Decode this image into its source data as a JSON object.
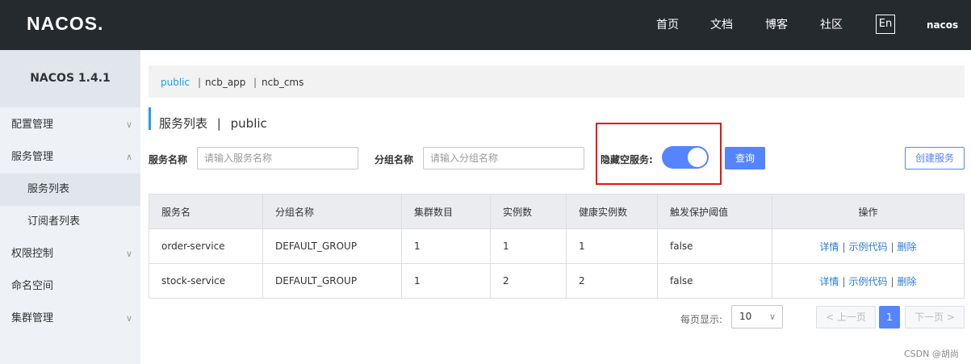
{
  "header": {
    "logo": "NACOS.",
    "nav": [
      "首页",
      "文档",
      "博客",
      "社区"
    ],
    "lang": "En",
    "user": "nacos"
  },
  "sidebar": {
    "version": "NACOS 1.4.1",
    "items": [
      {
        "label": "配置管理",
        "chevron": "∨"
      },
      {
        "label": "服务管理",
        "chevron": "∧"
      },
      {
        "label": "服务列表"
      },
      {
        "label": "订阅者列表"
      },
      {
        "label": "权限控制",
        "chevron": "∨"
      },
      {
        "label": "命名空间"
      },
      {
        "label": "集群管理",
        "chevron": "∨"
      }
    ]
  },
  "namespaces": [
    "public",
    "ncb_app",
    "ncb_cms"
  ],
  "namespace_sep": "|",
  "page": {
    "title": "服务列表",
    "title_sep": "|",
    "title_ns": "public"
  },
  "search": {
    "service_label": "服务名称",
    "service_placeholder": "请输入服务名称",
    "group_label": "分组名称",
    "group_placeholder": "请输入分组名称",
    "hide_empty_label": "隐藏空服务:",
    "hide_empty_on": true,
    "query_button": "查询",
    "create_button": "创建服务"
  },
  "table": {
    "headers": [
      "服务名",
      "分组名称",
      "集群数目",
      "实例数",
      "健康实例数",
      "触发保护阈值",
      "操作"
    ],
    "rows": [
      [
        "order-service",
        "DEFAULT_GROUP",
        "1",
        "1",
        "1",
        "false"
      ],
      [
        "stock-service",
        "DEFAULT_GROUP",
        "1",
        "2",
        "2",
        "false"
      ]
    ],
    "actions": [
      "详情",
      "示例代码",
      "删除"
    ],
    "action_sep": "|"
  },
  "pagination": {
    "page_size_label": "每页显示:",
    "page_size": "10",
    "prev": "上一页",
    "current": "1",
    "next": "下一页"
  },
  "watermark": "CSDN @胡尚",
  "colors": {
    "accent": "#5584ff",
    "link": "#2e7ad8",
    "highlight": "#ee1111",
    "topbar": "#252a2f"
  }
}
